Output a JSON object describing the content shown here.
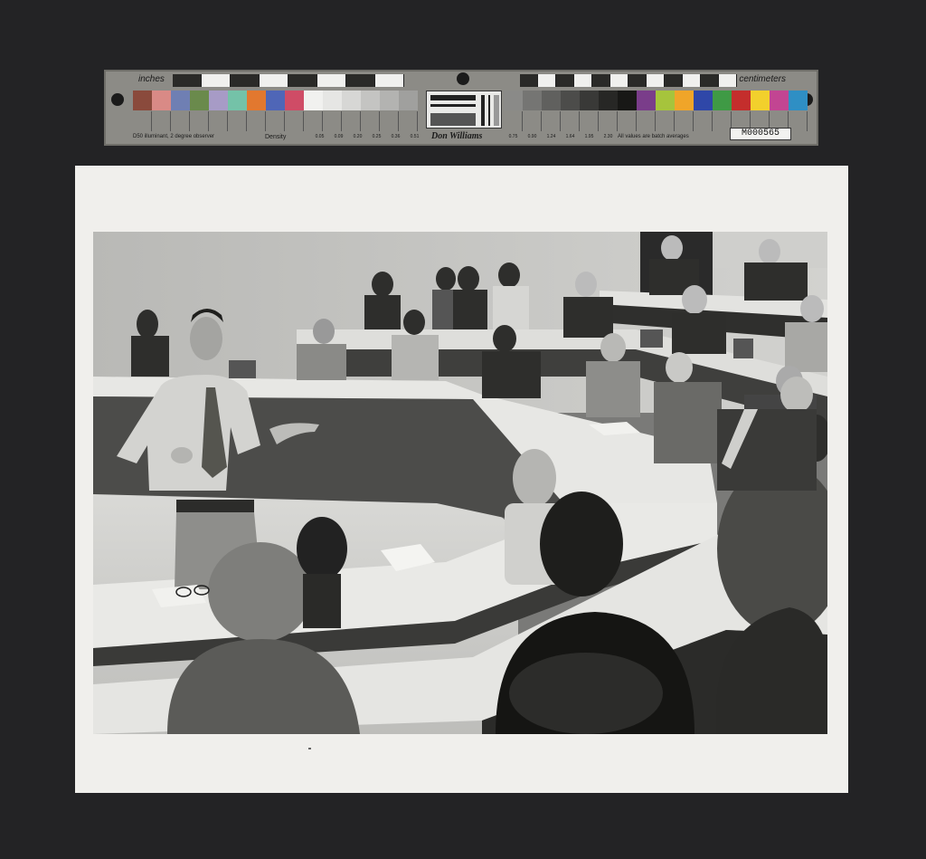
{
  "target": {
    "unit_left": "inches",
    "unit_right": "centimeters",
    "brand": "Don Williams",
    "density_label": "Density",
    "footnote_left": "D50 illuminant, 2 degree observer",
    "footnote_right": "All values are batch averages",
    "id": "M000565",
    "density_values": [
      "0.05",
      "0.09",
      "0.20",
      "0.25",
      "0.36",
      "0.51",
      "0.75",
      "0.90",
      "1.24",
      "1.64",
      "1.95",
      "2.30"
    ],
    "swatch_colors": [
      "#8a4a3c",
      "#d98a86",
      "#6f7fb3",
      "#6a8a4c",
      "#a79bc6",
      "#74c2a8",
      "#e2782f",
      "#4f66b7",
      "#cf4c66",
      "#f1f1ef",
      "#e6e6e4",
      "#d7d7d5",
      "#c4c4c2",
      "#b3b3b1",
      "#a0a09e",
      "#8a8a88",
      "#757573",
      "#60605e",
      "#4c4c4a",
      "#393937",
      "#272725",
      "#181816",
      "#7a3d8a",
      "#a6c43c",
      "#f0a529",
      "#2f47a8",
      "#3f9a45",
      "#c42e2c",
      "#f2d02c",
      "#c24592",
      "#2f8fc4"
    ]
  },
  "photo": {
    "subject": "black and white photograph",
    "tone": "grayscale"
  }
}
